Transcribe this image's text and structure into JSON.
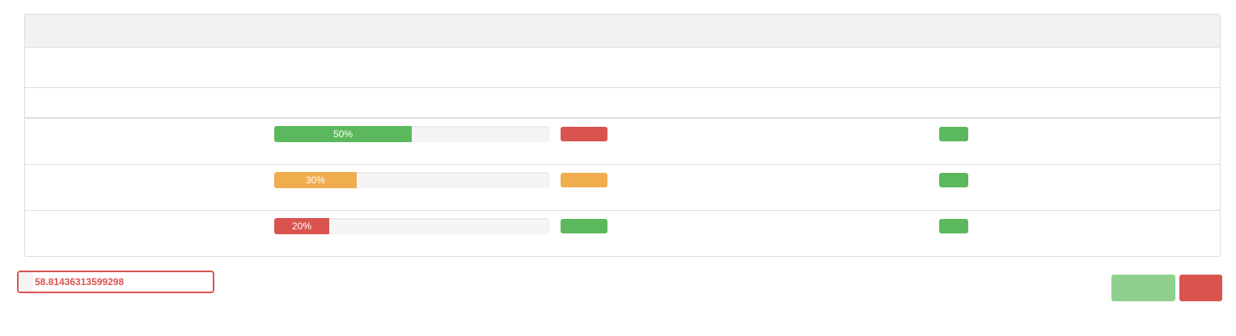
{
  "panel": {
    "heading": "",
    "description": ""
  },
  "table": {
    "headers": [
      "",
      "",
      "",
      ""
    ],
    "rows": [
      {
        "name": "",
        "progress": 50,
        "progress_label": "50%",
        "progress_color": "#5cb85c",
        "status": "",
        "status_color": "#d9534f",
        "flag": "",
        "flag_color": "#5cb85c"
      },
      {
        "name": "",
        "progress": 30,
        "progress_label": "30%",
        "progress_color": "#f0ad4e",
        "status": "",
        "status_color": "#f0ad4e",
        "flag": "",
        "flag_color": "#5cb85c"
      },
      {
        "name": "",
        "progress": 20,
        "progress_label": "20%",
        "progress_color": "#d9534f",
        "status": "",
        "status_color": "#5cb85c",
        "flag": "",
        "flag_color": "#5cb85c"
      }
    ]
  },
  "score": {
    "label": "",
    "value": "58.81436313599298"
  },
  "buttons": {
    "confirm_label": "",
    "cancel_label": ""
  },
  "colors": {
    "success": "#5cb85c",
    "warning": "#f0ad4e",
    "danger": "#d9534f"
  }
}
